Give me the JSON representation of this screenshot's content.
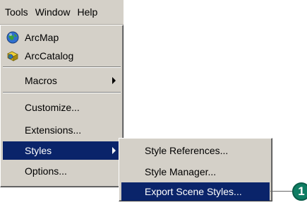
{
  "menubar": {
    "items": [
      "Tools",
      "Window",
      "Help"
    ]
  },
  "tools_menu": {
    "items": [
      {
        "label": "ArcMap",
        "icon": "globe-icon"
      },
      {
        "label": "ArcCatalog",
        "icon": "catalog-icon"
      },
      {
        "label": "Macros",
        "has_submenu": true
      },
      {
        "label": "Customize..."
      },
      {
        "label": "Extensions..."
      },
      {
        "label": "Styles",
        "has_submenu": true,
        "selected": true
      },
      {
        "label": "Options..."
      }
    ]
  },
  "styles_submenu": {
    "items": [
      {
        "label": "Style References..."
      },
      {
        "label": "Style Manager..."
      },
      {
        "label": "Export Scene Styles...",
        "selected": true
      }
    ]
  },
  "callout": {
    "number": "1"
  },
  "colors": {
    "menu_bg": "#d4d0c8",
    "highlight": "#0a246a",
    "callout": "#0f7d63"
  }
}
